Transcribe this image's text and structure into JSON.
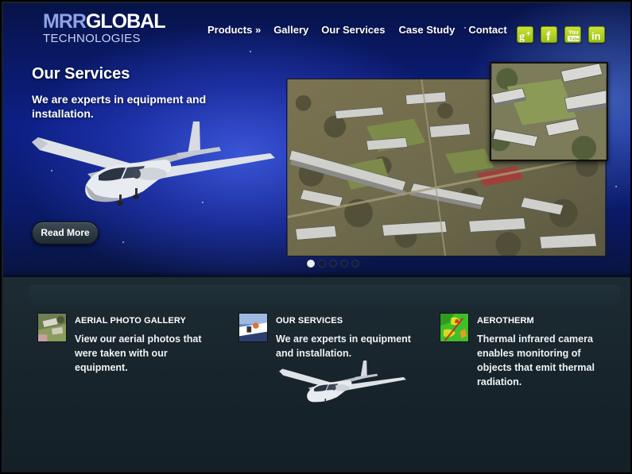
{
  "logo": {
    "part1": "MRR",
    "part2": "GLOBAL",
    "subtitle": "TECHNOLOGIES"
  },
  "nav": {
    "products": "Products »",
    "gallery": "Gallery",
    "services": "Our Services",
    "case_study": "Case Study",
    "contact": "Contact"
  },
  "social": [
    "google-plus-icon",
    "facebook-icon",
    "youtube-icon",
    "linkedin-icon"
  ],
  "hero": {
    "title": "Our Services",
    "text": "We are experts in equipment and installation.",
    "button": "Read More",
    "slide_count": 5,
    "active_slide": 1
  },
  "features": [
    {
      "title": "AERIAL PHOTO GALLERY",
      "text": "View our aerial photos that were taken with our equipment."
    },
    {
      "title": "OUR SERVICES",
      "text": "We are experts in equipment and installation."
    },
    {
      "title": "AEROTHERM",
      "text": "Thermal infrared camera enables monitoring of objects that emit thermal radiation."
    }
  ],
  "colors": {
    "accent_green": "#9cbf12",
    "hero_blue": "#0d1f86",
    "footer_bg": "#17232a"
  }
}
